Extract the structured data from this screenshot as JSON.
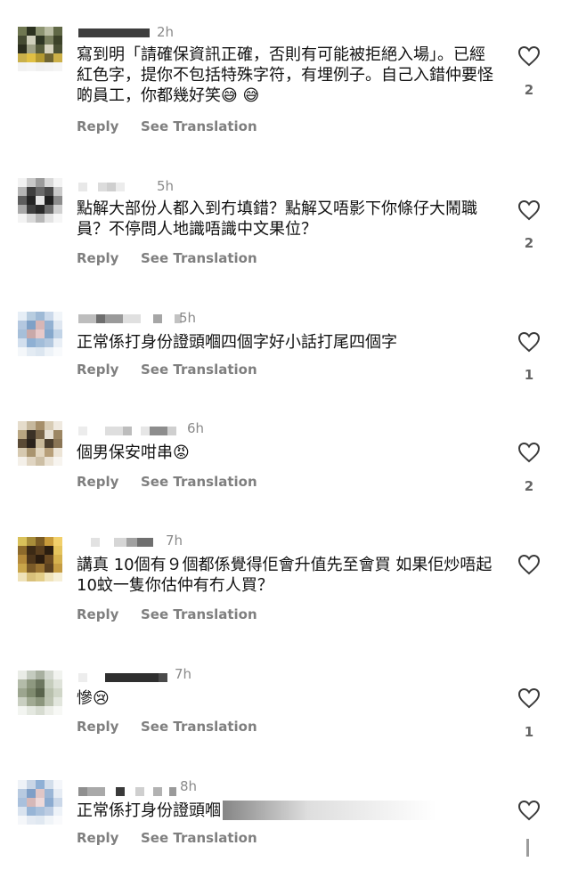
{
  "comments": [
    {
      "time": "2h",
      "text": "寫到明「請確保資訊正確，否則有可能被拒絕入場」。已經紅色字，提你不包括特殊字符，有埋例子。自己入錯仲要怪啲員工，你都幾好笑😅 😅",
      "reply": "Reply",
      "translate": "See Translation",
      "likes": "2"
    },
    {
      "time": "5h",
      "text": "點解大部份人都入到冇填錯？點解又唔影下你條仔大鬧職員？不停問人地識唔識中文果位？",
      "reply": "Reply",
      "translate": "See Translation",
      "likes": "2"
    },
    {
      "time": "5h",
      "text": "正常係打身份證頭嗰四個字好小話打尾四個字",
      "reply": "Reply",
      "translate": "See Translation",
      "likes": "1"
    },
    {
      "time": "6h",
      "text": "個男保安咁串😡",
      "reply": "Reply",
      "translate": "See Translation",
      "likes": "2"
    },
    {
      "time": "7h",
      "text": "講真 10個有９個都係覺得佢會升值先至會買 如果佢炒唔起 10蚊一隻你估仲有冇人買？",
      "reply": "Reply",
      "translate": "See Translation",
      "likes": ""
    },
    {
      "time": "7h",
      "text": "慘😢",
      "reply": "Reply",
      "translate": "See Translation",
      "likes": "1"
    },
    {
      "time": "8h",
      "text": "正常係打身份證頭嗰",
      "reply": "Reply",
      "translate": "See Translation",
      "likes": ""
    }
  ],
  "colors": {
    "heart_stroke": "#3a3a3a",
    "muted": "#7f7f7f",
    "time": "#8a8a8a"
  },
  "icons": {
    "like": "heart-outline-icon"
  }
}
